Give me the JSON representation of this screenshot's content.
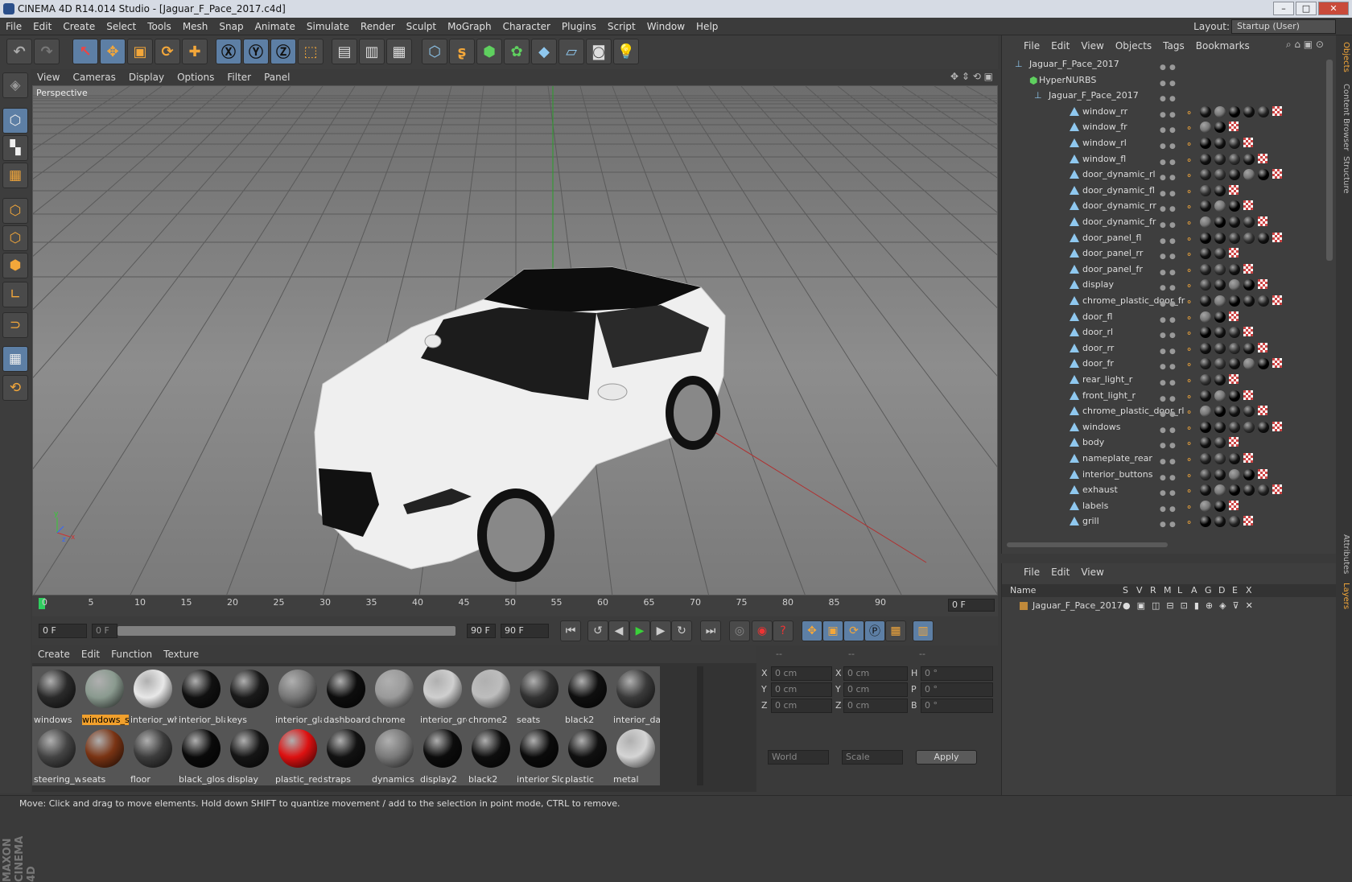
{
  "window": {
    "title": "CINEMA 4D R14.014 Studio - [Jaguar_F_Pace_2017.c4d]",
    "min": "–",
    "max": "□",
    "close": "✕"
  },
  "menu": [
    "File",
    "Edit",
    "Create",
    "Select",
    "Tools",
    "Mesh",
    "Snap",
    "Animate",
    "Simulate",
    "Render",
    "Sculpt",
    "MoGraph",
    "Character",
    "Plugins",
    "Script",
    "Window",
    "Help"
  ],
  "layout": {
    "label": "Layout:",
    "value": "Startup (User)"
  },
  "viewport_menu": [
    "View",
    "Cameras",
    "Display",
    "Options",
    "Filter",
    "Panel"
  ],
  "viewport_label": "Perspective",
  "timeline": {
    "ticks": [
      "0",
      "5",
      "10",
      "15",
      "20",
      "25",
      "30",
      "35",
      "40",
      "45",
      "50",
      "55",
      "60",
      "65",
      "70",
      "75",
      "80",
      "85",
      "90"
    ],
    "current": "0 F"
  },
  "transport": {
    "start": "0 F",
    "range_start": "0 F",
    "range_end": "90 F",
    "end": "90 F"
  },
  "materials_menu": [
    "Create",
    "Edit",
    "Function",
    "Texture"
  ],
  "materials": [
    {
      "name": "windows",
      "color": "#2a2a2a"
    },
    {
      "name": "windows_s",
      "color": "#8a9a8f",
      "selected": true
    },
    {
      "name": "interior_wh",
      "color": "#e8e8e8"
    },
    {
      "name": "interior_bla",
      "color": "#111111"
    },
    {
      "name": "keys",
      "color": "#1a1a1a"
    },
    {
      "name": "interior_gla",
      "color": "#777777"
    },
    {
      "name": "dashboard",
      "color": "#0d0d0d"
    },
    {
      "name": "chrome",
      "color": "#9a9a9a"
    },
    {
      "name": "interior_gre",
      "color": "#cfcfcf"
    },
    {
      "name": "chrome2",
      "color": "#bdbdbd"
    },
    {
      "name": "seats",
      "color": "#333333"
    },
    {
      "name": "black2",
      "color": "#0f0f0f"
    },
    {
      "name": "interior_da",
      "color": "#3a3a3a"
    },
    {
      "name": "steering_w",
      "color": "#444444"
    },
    {
      "name": "seats",
      "color": "#7a3414"
    },
    {
      "name": "floor",
      "color": "#3d3d3d"
    },
    {
      "name": "black_gloss",
      "color": "#0a0a0a"
    },
    {
      "name": "display",
      "color": "#151515"
    },
    {
      "name": "plastic_red",
      "color": "#dd1111"
    },
    {
      "name": "straps",
      "color": "#121212"
    },
    {
      "name": "dynamics",
      "color": "#7a7a7a"
    },
    {
      "name": "display2",
      "color": "#0c0c0c"
    },
    {
      "name": "black2",
      "color": "#0e0e0e"
    },
    {
      "name": "interior Slo",
      "color": "#0b0b0b"
    },
    {
      "name": "plastic",
      "color": "#101010"
    },
    {
      "name": "metal",
      "color": "#d5d5d5"
    }
  ],
  "coords": {
    "rows": [
      {
        "a": "X",
        "av": "0 cm",
        "b": "X",
        "bv": "0 cm",
        "c": "H",
        "cv": "0 °"
      },
      {
        "a": "Y",
        "av": "0 cm",
        "b": "Y",
        "bv": "0 cm",
        "c": "P",
        "cv": "0 °"
      },
      {
        "a": "Z",
        "av": "0 cm",
        "b": "Z",
        "bv": "0 cm",
        "c": "B",
        "cv": "0 °"
      }
    ],
    "world": "World",
    "scale": "Scale",
    "apply": "Apply",
    "dash1": "--",
    "dash2": "--",
    "dash3": "--"
  },
  "objects_menu": [
    "File",
    "Edit",
    "View",
    "Objects",
    "Tags",
    "Bookmarks"
  ],
  "objects": [
    {
      "name": "Jaguar_F_Pace_2017",
      "kind": "null",
      "indent": 0
    },
    {
      "name": "HyperNURBS",
      "kind": "nurbs",
      "indent": 1
    },
    {
      "name": "Jaguar_F_Pace_2017",
      "kind": "null",
      "indent": 2
    },
    {
      "name": "window_rr",
      "kind": "poly",
      "indent": 3
    },
    {
      "name": "window_fr",
      "kind": "poly",
      "indent": 3
    },
    {
      "name": "window_rl",
      "kind": "poly",
      "indent": 3
    },
    {
      "name": "window_fl",
      "kind": "poly",
      "indent": 3
    },
    {
      "name": "door_dynamic_rl",
      "kind": "poly",
      "indent": 3
    },
    {
      "name": "door_dynamic_fl",
      "kind": "poly",
      "indent": 3
    },
    {
      "name": "door_dynamic_rr",
      "kind": "poly",
      "indent": 3
    },
    {
      "name": "door_dynamic_fr",
      "kind": "poly",
      "indent": 3
    },
    {
      "name": "door_panel_fl",
      "kind": "poly",
      "indent": 3
    },
    {
      "name": "door_panel_rr",
      "kind": "poly",
      "indent": 3
    },
    {
      "name": "door_panel_fr",
      "kind": "poly",
      "indent": 3
    },
    {
      "name": "display",
      "kind": "poly",
      "indent": 3
    },
    {
      "name": "chrome_plastic_door_fr",
      "kind": "poly",
      "indent": 3
    },
    {
      "name": "door_fl",
      "kind": "poly",
      "indent": 3
    },
    {
      "name": "door_rl",
      "kind": "poly",
      "indent": 3
    },
    {
      "name": "door_rr",
      "kind": "poly",
      "indent": 3
    },
    {
      "name": "door_fr",
      "kind": "poly",
      "indent": 3
    },
    {
      "name": "rear_light_r",
      "kind": "poly",
      "indent": 3
    },
    {
      "name": "front_light_r",
      "kind": "poly",
      "indent": 3
    },
    {
      "name": "chrome_plastic_door_rl",
      "kind": "poly",
      "indent": 3
    },
    {
      "name": "windows",
      "kind": "poly",
      "indent": 3
    },
    {
      "name": "body",
      "kind": "poly",
      "indent": 3
    },
    {
      "name": "nameplate_rear",
      "kind": "poly",
      "indent": 3
    },
    {
      "name": "interior_buttons",
      "kind": "poly",
      "indent": 3
    },
    {
      "name": "exhaust",
      "kind": "poly",
      "indent": 3
    },
    {
      "name": "labels",
      "kind": "poly",
      "indent": 3
    },
    {
      "name": "grill",
      "kind": "poly",
      "indent": 3
    }
  ],
  "layers_menu": [
    "File",
    "Edit",
    "View"
  ],
  "layers_header": {
    "name": "Name",
    "cols": [
      "S",
      "V",
      "R",
      "M",
      "L",
      "A",
      "G",
      "D",
      "E",
      "X"
    ]
  },
  "layers": [
    {
      "name": "Jaguar_F_Pace_2017",
      "color": "#c0893a"
    }
  ],
  "side_tabs": [
    "Objects",
    "Content Browser",
    "Structure",
    "Attributes",
    "Layers"
  ],
  "status": "Move: Click and drag to move elements. Hold down SHIFT to quantize movement / add to the selection in point mode, CTRL to remove."
}
